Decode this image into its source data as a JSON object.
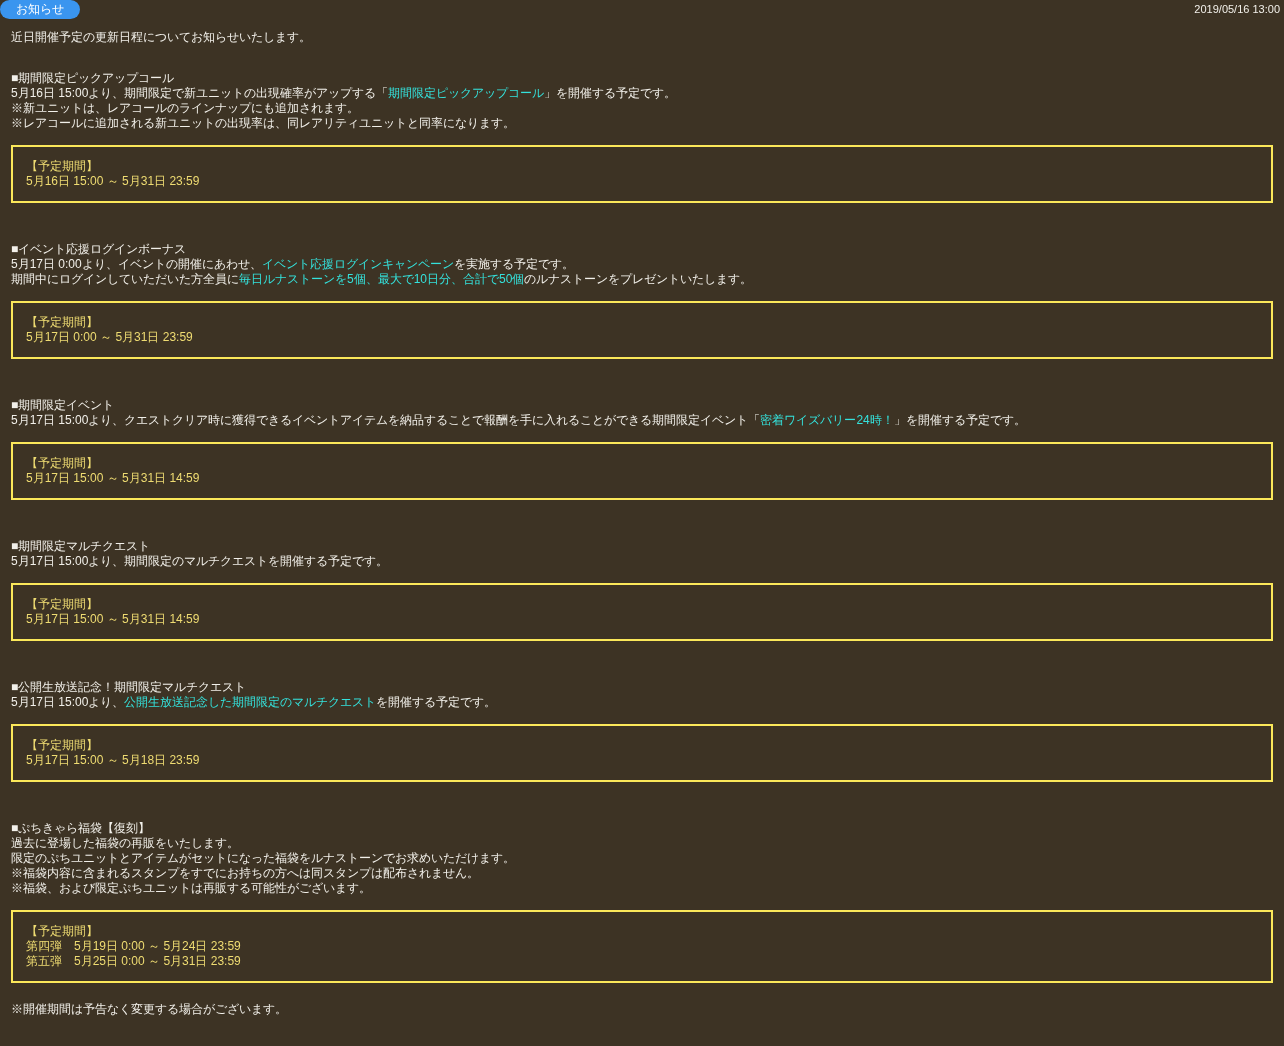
{
  "header": {
    "badge": "お知らせ",
    "date": "2019/05/16 13:00"
  },
  "intro": "近日開催予定の更新日程についてお知らせいたします。",
  "sections": [
    {
      "title": "■期間限定ピックアップコール",
      "lines": [
        [
          {
            "text": "5月16日 15:00より、期間限定で新ユニットの出現確率がアップする「",
            "highlight": false
          },
          {
            "text": "期間限定ピックアップコール",
            "highlight": true
          },
          {
            "text": "」を開催する予定です。",
            "highlight": false
          }
        ],
        [
          {
            "text": "※新ユニットは、レアコールのラインナップにも追加されます。",
            "highlight": false
          }
        ],
        [
          {
            "text": "※レアコールに追加される新ユニットの出現率は、同レアリティユニットと同率になります。",
            "highlight": false
          }
        ]
      ],
      "period": {
        "heading": "【予定期間】",
        "lines": [
          "5月16日 15:00 ～ 5月31日 23:59"
        ]
      }
    },
    {
      "title": "■イベント応援ログインボーナス",
      "lines": [
        [
          {
            "text": "5月17日 0:00より、イベントの開催にあわせ、",
            "highlight": false
          },
          {
            "text": "イベント応援ログインキャンペーン",
            "highlight": true
          },
          {
            "text": "を実施する予定です。",
            "highlight": false
          }
        ],
        [
          {
            "text": "期間中にログインしていただいた方全員に",
            "highlight": false
          },
          {
            "text": "毎日ルナストーンを5個、最大で10日分、合計で50個",
            "highlight": true
          },
          {
            "text": "のルナストーンをプレゼントいたします。",
            "highlight": false
          }
        ]
      ],
      "period": {
        "heading": "【予定期間】",
        "lines": [
          "5月17日 0:00 ～ 5月31日 23:59"
        ]
      }
    },
    {
      "title": "■期間限定イベント",
      "lines": [
        [
          {
            "text": "5月17日 15:00より、クエストクリア時に獲得できるイベントアイテムを納品することで報酬を手に入れることができる期間限定イベント「",
            "highlight": false
          },
          {
            "text": "密着ワイズバリー24時！",
            "highlight": true
          },
          {
            "text": "」を開催する予定です。",
            "highlight": false
          }
        ]
      ],
      "period": {
        "heading": "【予定期間】",
        "lines": [
          "5月17日 15:00 ～ 5月31日 14:59"
        ]
      }
    },
    {
      "title": "■期間限定マルチクエスト",
      "lines": [
        [
          {
            "text": "5月17日 15:00より、期間限定のマルチクエストを開催する予定です。",
            "highlight": false
          }
        ]
      ],
      "period": {
        "heading": "【予定期間】",
        "lines": [
          "5月17日 15:00 ～ 5月31日 14:59"
        ]
      }
    },
    {
      "title": "■公開生放送記念！期間限定マルチクエスト",
      "lines": [
        [
          {
            "text": "5月17日 15:00より、",
            "highlight": false
          },
          {
            "text": "公開生放送記念した期間限定のマルチクエスト",
            "highlight": true
          },
          {
            "text": "を開催する予定です。",
            "highlight": false
          }
        ]
      ],
      "period": {
        "heading": "【予定期間】",
        "lines": [
          "5月17日 15:00 ～ 5月18日 23:59"
        ]
      }
    },
    {
      "title": "■ぷちきゃら福袋【復刻】",
      "lines": [
        [
          {
            "text": "過去に登場した福袋の再販をいたします。",
            "highlight": false
          }
        ],
        [
          {
            "text": "限定のぷちユニットとアイテムがセットになった福袋をルナストーンでお求めいただけます。",
            "highlight": false
          }
        ],
        [
          {
            "text": "※福袋内容に含まれるスタンプをすでにお持ちの方へは同スタンプは配布されません。",
            "highlight": false
          }
        ],
        [
          {
            "text": "※福袋、および限定ぷちユニットは再販する可能性がございます。",
            "highlight": false
          }
        ]
      ],
      "period": {
        "heading": "【予定期間】",
        "lines": [
          "第四弾　5月19日 0:00 ～ 5月24日 23:59",
          "第五弾　5月25日 0:00 ～ 5月31日 23:59"
        ]
      }
    }
  ],
  "footer_note": "※開催期間は予告なく変更する場合がございます。"
}
